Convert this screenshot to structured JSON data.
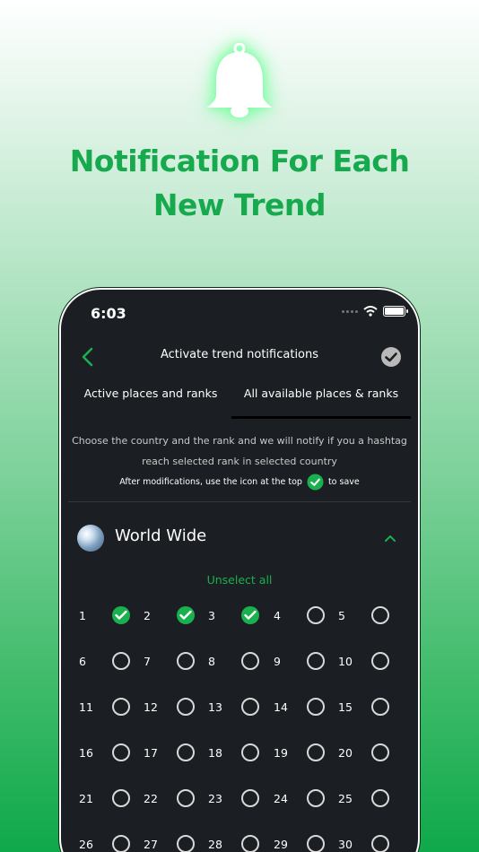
{
  "headline": {
    "line1": "Notification For Each",
    "line2": "New Trend"
  },
  "status_bar": {
    "time": "6:03"
  },
  "nav": {
    "title": "Activate trend notifications"
  },
  "tabs": [
    {
      "label": "Active places and ranks",
      "selected": false
    },
    {
      "label": "All available places & ranks",
      "selected": true
    }
  ],
  "description": {
    "line1": "Choose the country and the rank and we will notify if you a hashtag",
    "line2": "reach selected rank in selected country",
    "hint_before": "After modifications, use the icon at the top",
    "hint_after": "to save"
  },
  "region": {
    "name": "World Wide",
    "action": "Unselect all"
  },
  "ranks": [
    {
      "label": "1",
      "checked": true
    },
    {
      "label": "2",
      "checked": true
    },
    {
      "label": "3",
      "checked": true
    },
    {
      "label": "4",
      "checked": false
    },
    {
      "label": "5",
      "checked": false
    },
    {
      "label": "6",
      "checked": false
    },
    {
      "label": "7",
      "checked": false
    },
    {
      "label": "8",
      "checked": false
    },
    {
      "label": "9",
      "checked": false
    },
    {
      "label": "10",
      "checked": false
    },
    {
      "label": "11",
      "checked": false
    },
    {
      "label": "12",
      "checked": false
    },
    {
      "label": "13",
      "checked": false
    },
    {
      "label": "14",
      "checked": false
    },
    {
      "label": "15",
      "checked": false
    },
    {
      "label": "16",
      "checked": false
    },
    {
      "label": "17",
      "checked": false
    },
    {
      "label": "18",
      "checked": false
    },
    {
      "label": "19",
      "checked": false
    },
    {
      "label": "20",
      "checked": false
    },
    {
      "label": "21",
      "checked": false
    },
    {
      "label": "22",
      "checked": false
    },
    {
      "label": "23",
      "checked": false
    },
    {
      "label": "24",
      "checked": false
    },
    {
      "label": "25",
      "checked": false
    },
    {
      "label": "26",
      "checked": false
    },
    {
      "label": "27",
      "checked": false
    },
    {
      "label": "28",
      "checked": false
    },
    {
      "label": "29",
      "checked": false
    },
    {
      "label": "30",
      "checked": false
    }
  ],
  "colors": {
    "accent": "#19b04f",
    "headline": "#17a94d",
    "panel": "#1b1e22"
  }
}
